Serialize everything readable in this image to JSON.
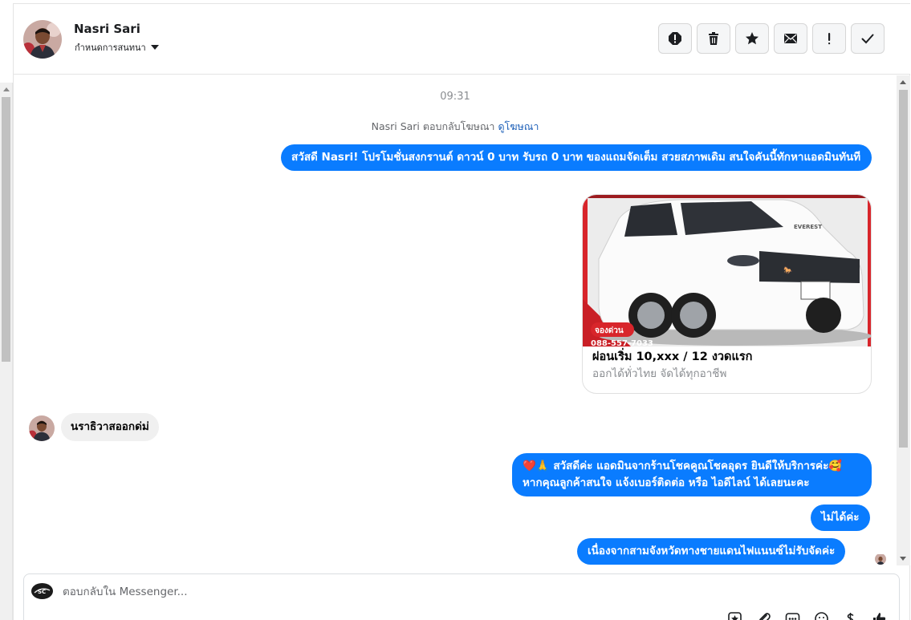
{
  "header": {
    "contact_name": "Nasri Sari",
    "assign_label": "กำหนดการสนทนา"
  },
  "toolbar": {
    "buttons": [
      "report-icon",
      "trash-icon",
      "star-icon",
      "envelope-icon",
      "exclamation-icon",
      "check-icon"
    ]
  },
  "chat": {
    "timestamp": "09:31",
    "reply_note_prefix": "Nasri Sari ตอบกลับโฆษณา",
    "reply_note_link": "ดูโฆษณา",
    "ad_message": "สวัสดี Nasri! โปรโมชั่นสงกรานต์ ดาวน์ 0 บาท รับรถ 0 บาท ของแถมจัดเต็ม สวยสภาพเดิม สนใจคันนี้ทักหาแอดมินทันที",
    "ad_card": {
      "badge": "จองด่วน",
      "phone": "088-557-7033",
      "plate_brand": "EVEREST",
      "title": "ผ่อนเริ่ม 10,xxx / 12 งวดแรก",
      "subtitle": "ออกได้ทั่วไทย จัดได้ทุกอาชีพ"
    },
    "incoming_message": "นราธิวาสออกด่ม่",
    "reply_1": "❤️🙏 สวัสดีค่ะ แอดมินจากร้านโชคคูณโชคอุดร ยินดีให้บริการค่ะ🥰 หากคุณลูกค้าสนใจ แจ้งเบอร์ติดต่อ หรือ ไอดีไลน์ ได้เลยนะคะ",
    "reply_2": "ไม่ได้ค่ะ",
    "reply_3": "เนื่องจากสามจังหวัดทางชายแดนไฟแนนซ์ไม่รับจัดค่ะ"
  },
  "composer": {
    "placeholder": "ตอบกลับใน Messenger...",
    "page_logo_text": "SC",
    "tools": [
      "saved-reply-icon",
      "attachment-icon",
      "more-icon",
      "emoji-icon",
      "payment-icon",
      "like-icon"
    ]
  },
  "colors": {
    "accent": "#0a7cff",
    "bubble_in": "#f0f0f0",
    "link": "#1c5fb8"
  }
}
